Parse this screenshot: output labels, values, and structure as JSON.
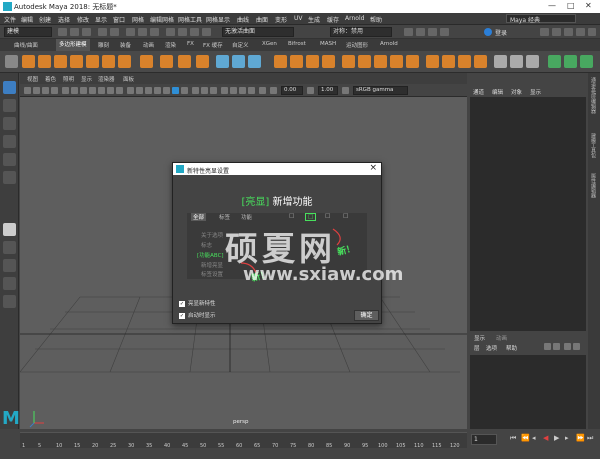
{
  "window": {
    "title": "Autodesk Maya 2018: 无标题*",
    "controls": [
      "—",
      "□",
      "✕"
    ]
  },
  "menu": {
    "items": [
      "文件",
      "编辑",
      "创建",
      "选择",
      "修改",
      "显示",
      "窗口",
      "网格",
      "编辑网格",
      "网格工具",
      "网格显示",
      "曲线",
      "曲面",
      "变形",
      "UV",
      "生成",
      "缓存",
      "Arnold",
      "帮助"
    ],
    "workspace": "Maya 经典"
  },
  "status": {
    "mode": "建模",
    "live_surface": "无激活曲面",
    "symmetry": "对称：禁用",
    "login": "登录"
  },
  "shelf_tabs": [
    "曲线/曲面",
    "多边形建模",
    "雕刻",
    "装备",
    "动画",
    "渲染",
    "FX",
    "FX 缓存",
    "自定义",
    "XGen",
    "Bifrost",
    "MASH",
    "运动图形",
    "Arnold"
  ],
  "shelf_active": "多边形建模",
  "viewport": {
    "menu": [
      "视图",
      "着色",
      "照明",
      "显示",
      "渲染器",
      "面板"
    ],
    "field1": "0.00",
    "field2": "1.00",
    "color_space": "sRGB gamma",
    "camera": "persp"
  },
  "channel_box": {
    "tabs": [
      "通道",
      "编辑",
      "对象",
      "显示"
    ]
  },
  "layer_editor": {
    "tabs": [
      "显示",
      "动画"
    ],
    "menu": [
      "层",
      "选项",
      "帮助"
    ]
  },
  "side_tabs": [
    "通道盒/层编辑器",
    "建模工具包",
    "属性编辑器"
  ],
  "timeline": {
    "ticks": [
      "1",
      "5",
      "10",
      "15",
      "20",
      "25",
      "30",
      "35",
      "40",
      "45",
      "50",
      "55",
      "60",
      "65",
      "70",
      "75",
      "80",
      "85",
      "90",
      "95",
      "100",
      "105",
      "110",
      "115",
      "120"
    ],
    "current": "1"
  },
  "dialog": {
    "title": "新特性亮显设置",
    "heading_bracket": "[亮显]",
    "heading_text": "新增功能",
    "panel_tabs": [
      "全部",
      "标签",
      "功能",
      "□",
      "□",
      "□",
      "□"
    ],
    "options": [
      "关于选项",
      "标志",
      "[功能ABC]",
      "新增亮显",
      "标签设置"
    ],
    "new_label": "新！",
    "checkbox1": "亮显新特性",
    "checkbox2": "启动时显示",
    "ok": "确定"
  },
  "watermark": {
    "line1": "硕夏网",
    "line2": "www.sxiaw.com"
  },
  "colors": {
    "accent": "#23a9c5",
    "highlight": "#48e05d",
    "viewport_bg": "#5e5e5e"
  }
}
